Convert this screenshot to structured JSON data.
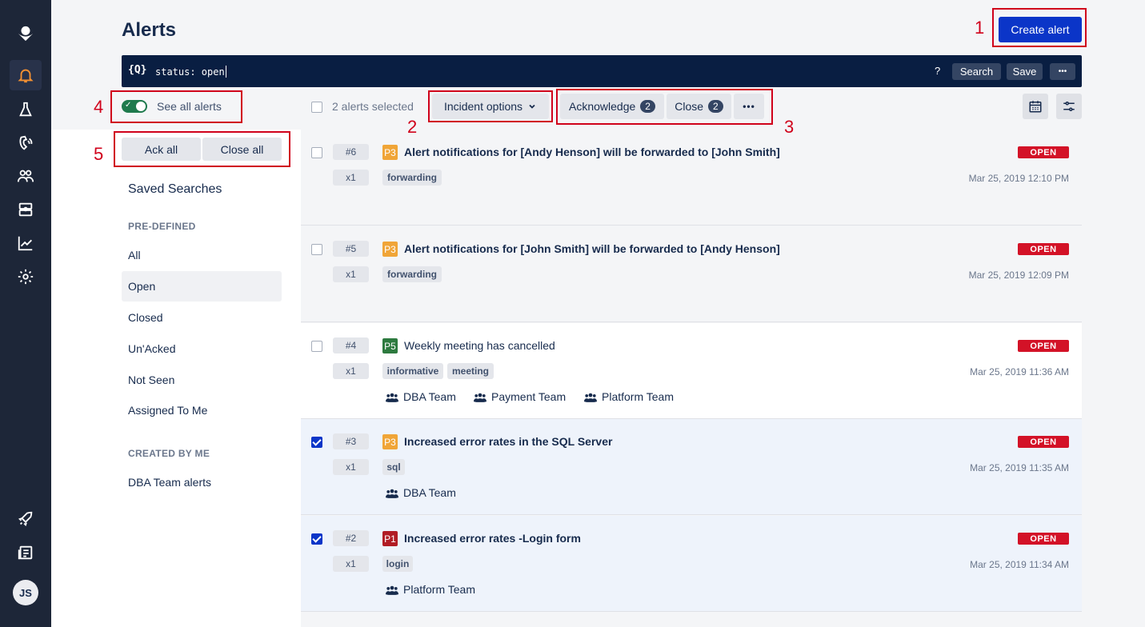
{
  "page": {
    "title": "Alerts",
    "create_label": "Create alert"
  },
  "nav": {
    "avatar_initials": "JS"
  },
  "search": {
    "icon_text": "{Q}",
    "query": "status: open",
    "help": "?",
    "search_label": "Search",
    "save_label": "Save",
    "more_label": "•••"
  },
  "toolbar": {
    "see_all_label": "See all alerts",
    "selected_text": "2 alerts selected",
    "incident_options_label": "Incident options",
    "acknowledge_label": "Acknowledge",
    "acknowledge_count": "2",
    "close_label": "Close",
    "close_count": "2",
    "more_label": "•••"
  },
  "left_panel": {
    "ack_all_label": "Ack all",
    "close_all_label": "Close all",
    "saved_title": "Saved Searches",
    "predefined_label": "PRE-DEFINED",
    "predefined": [
      "All",
      "Open",
      "Closed",
      "Un'Acked",
      "Not Seen",
      "Assigned To Me"
    ],
    "created_label": "CREATED BY ME",
    "created": [
      "DBA Team alerts"
    ]
  },
  "annotations": [
    "1",
    "2",
    "3",
    "4",
    "5"
  ],
  "alerts": [
    {
      "id": "#6",
      "count": "x1",
      "priority": "P3",
      "priority_color": "#f0a537",
      "title": "Alert notifications for [Andy Henson] will be forwarded to [John Smith]",
      "status": "OPEN",
      "date": "Mar 25, 2019 12:10 PM",
      "tags": [
        "forwarding"
      ],
      "teams": [],
      "checked": false
    },
    {
      "id": "#5",
      "count": "x1",
      "priority": "P3",
      "priority_color": "#f0a537",
      "title": "Alert notifications for [John Smith] will be forwarded to [Andy Henson]",
      "status": "OPEN",
      "date": "Mar 25, 2019 12:09 PM",
      "tags": [
        "forwarding"
      ],
      "teams": [],
      "checked": false
    },
    {
      "id": "#4",
      "count": "x1",
      "priority": "P5",
      "priority_color": "#2d7a3f",
      "title": "Weekly meeting has cancelled",
      "status": "OPEN",
      "date": "Mar 25, 2019 11:36 AM",
      "tags": [
        "informative",
        "meeting"
      ],
      "teams": [
        "DBA Team",
        "Payment Team",
        "Platform Team"
      ],
      "checked": false
    },
    {
      "id": "#3",
      "count": "x1",
      "priority": "P3",
      "priority_color": "#f0a537",
      "title": "Increased error rates in the SQL Server",
      "status": "OPEN",
      "date": "Mar 25, 2019 11:35 AM",
      "tags": [
        "sql"
      ],
      "teams": [
        "DBA Team"
      ],
      "checked": true
    },
    {
      "id": "#2",
      "count": "x1",
      "priority": "P1",
      "priority_color": "#b11c24",
      "title": "Increased error rates -Login form",
      "status": "OPEN",
      "date": "Mar 25, 2019 11:34 AM",
      "tags": [
        "login"
      ],
      "teams": [
        "Platform Team"
      ],
      "checked": true
    }
  ]
}
